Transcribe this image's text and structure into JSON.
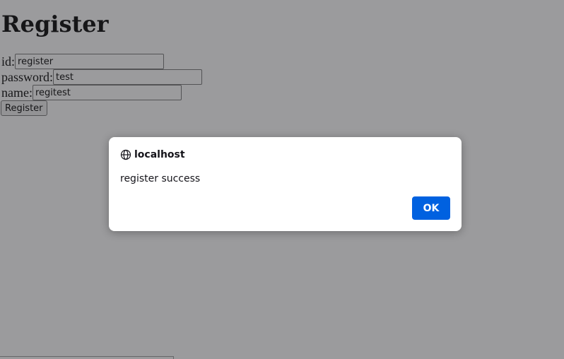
{
  "page": {
    "heading": "Register",
    "form": {
      "id_label": "id:",
      "id_value": "register",
      "password_label": "password:",
      "password_value": "test",
      "name_label": "name:",
      "name_value": "regitest",
      "submit_label": "Register"
    }
  },
  "dialog": {
    "origin": "localhost",
    "origin_icon": "globe-icon",
    "message": "register success",
    "ok_label": "OK"
  },
  "colors": {
    "overlay": "#99999b",
    "primary_button": "#0061e0",
    "dialog_background": "#ffffff"
  }
}
